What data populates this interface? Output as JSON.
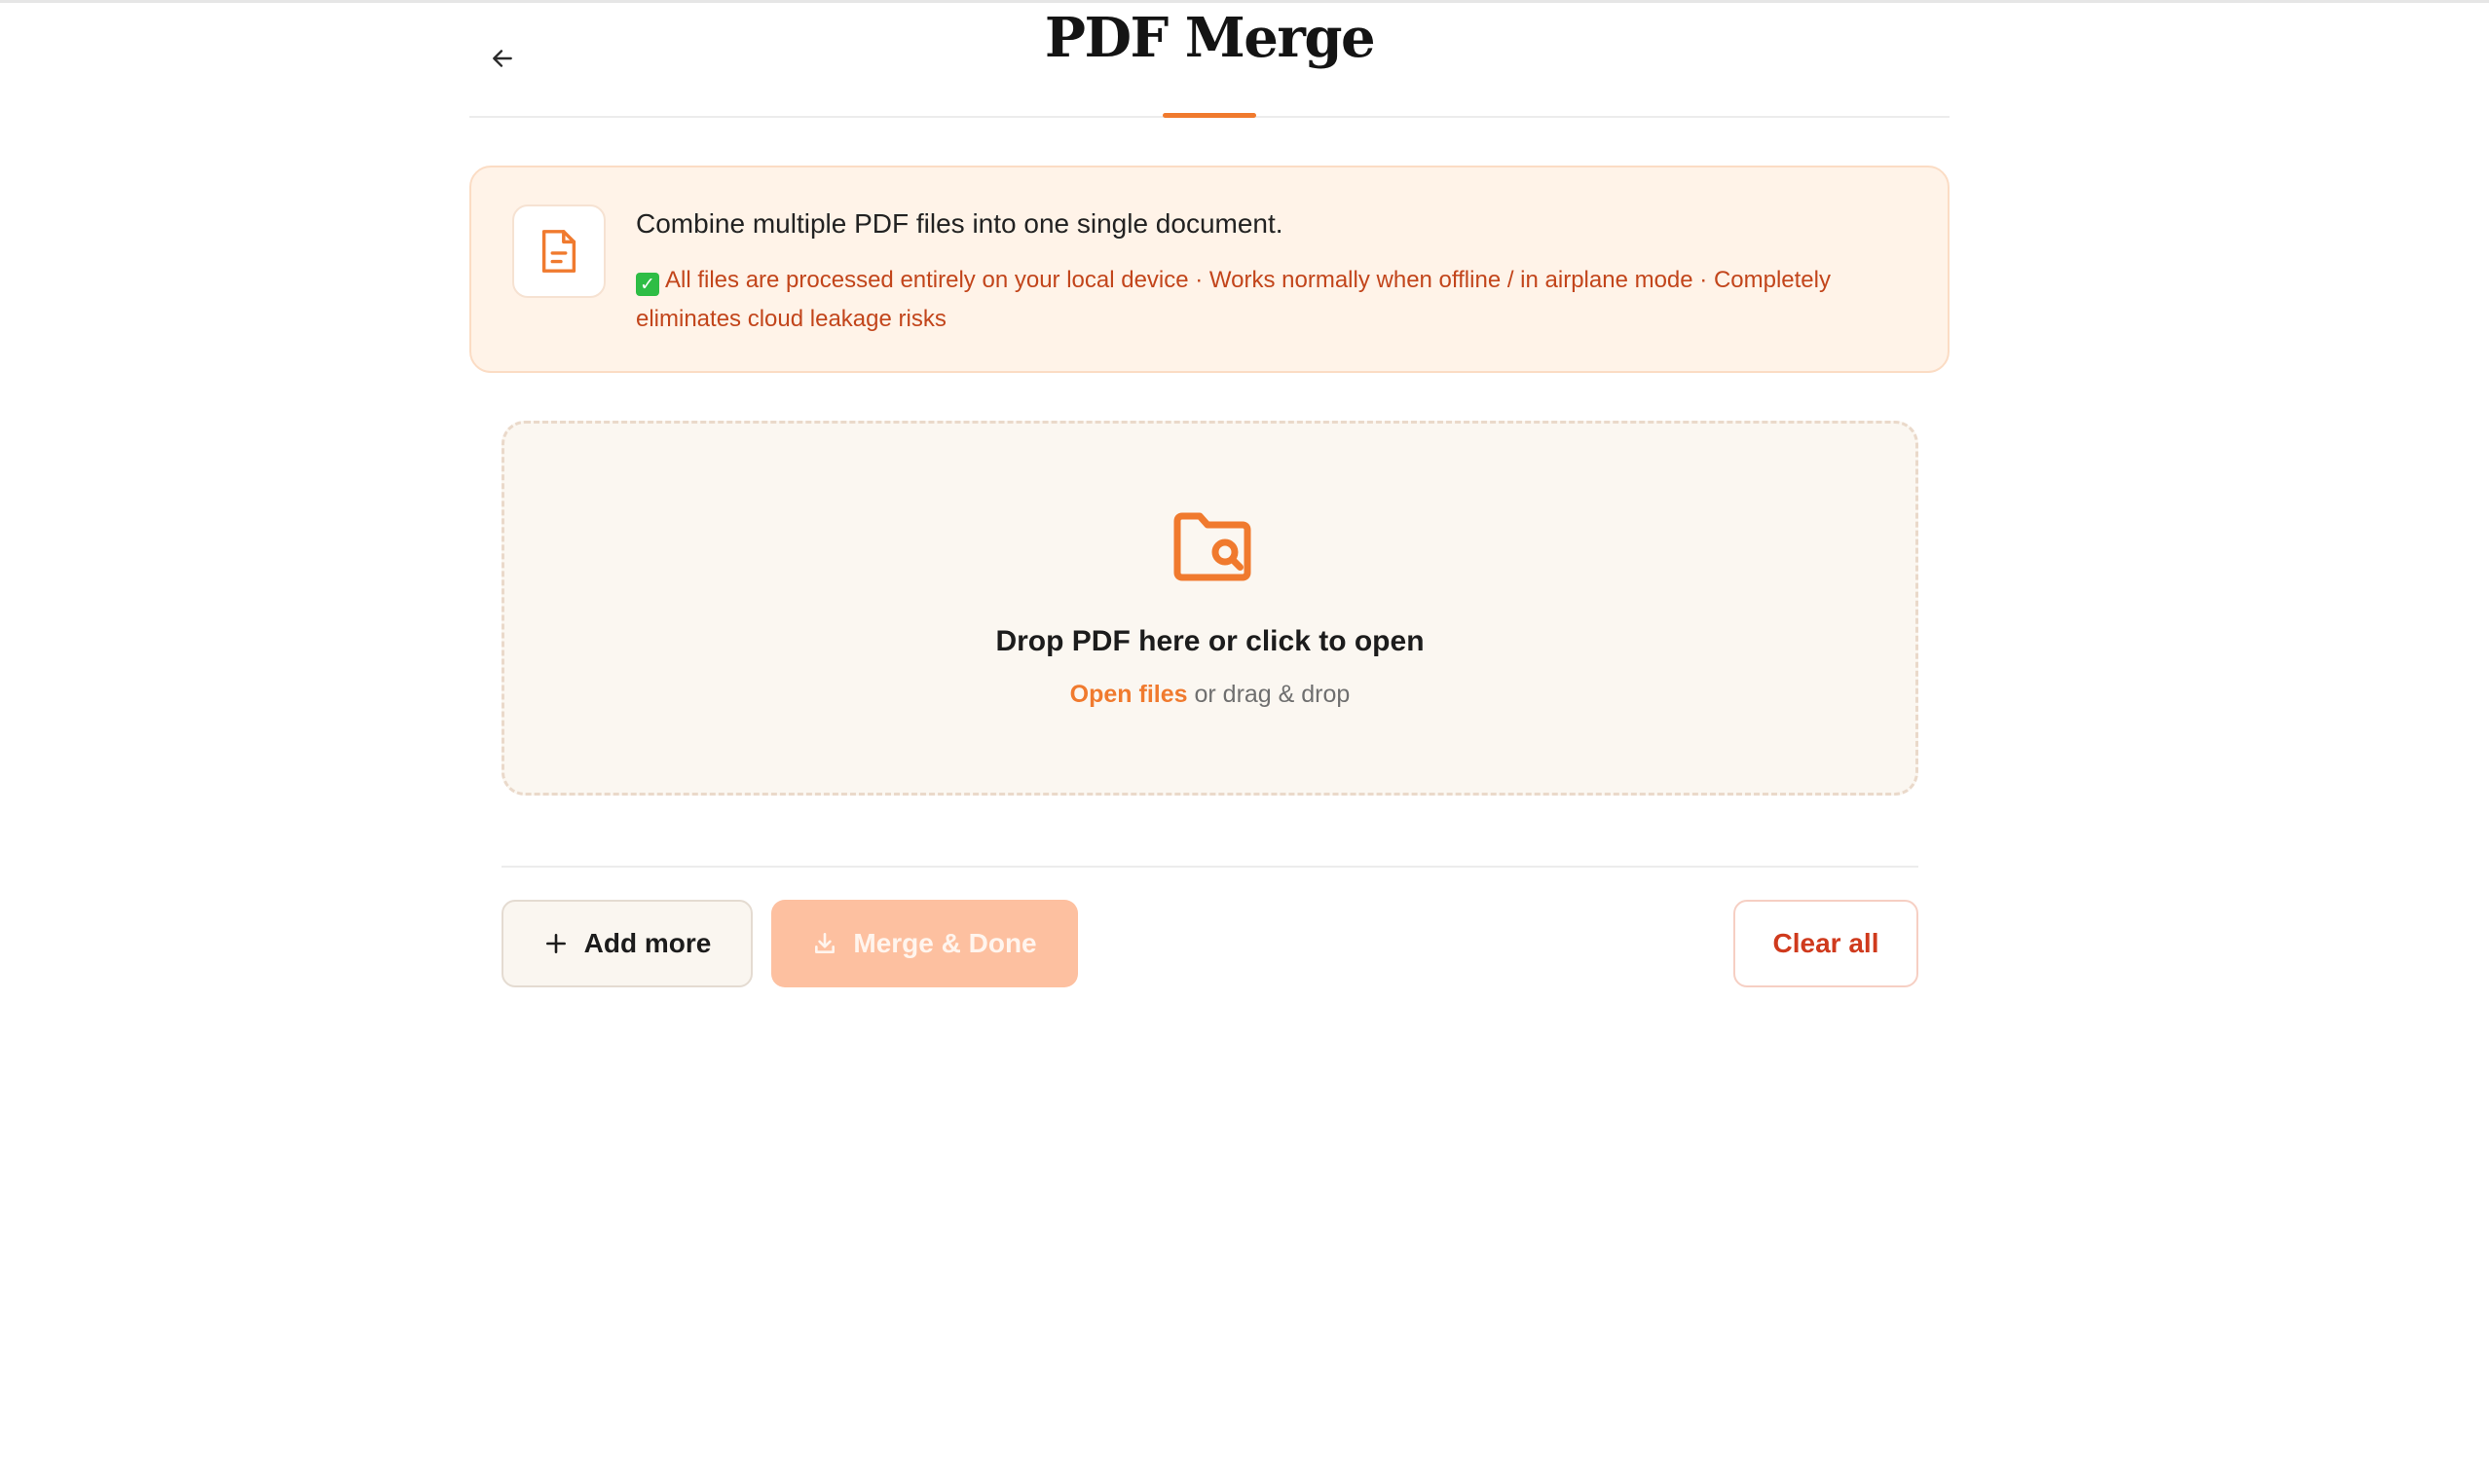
{
  "header": {
    "title": "PDF Merge",
    "back_icon": "arrow-left-icon"
  },
  "banner": {
    "icon": "document-icon",
    "title": "Combine multiple PDF files into one single document.",
    "note_check_icon": "check-box-icon",
    "note": "All files are processed entirely on your local device · Works normally when offline / in airplane mode · Completely eliminates cloud leakage risks"
  },
  "dropzone": {
    "icon": "folder-search-icon",
    "title": "Drop PDF here or click to open",
    "link_label": "Open files",
    "sub_label": " or drag & drop"
  },
  "actions": {
    "add_label": "Add more",
    "add_icon": "plus-icon",
    "merge_label": "Merge & Done",
    "merge_icon": "download-icon",
    "clear_label": "Clear all"
  },
  "colors": {
    "accent": "#f07a2e",
    "banner_bg": "#fff3e8",
    "warning_text": "#c2451b",
    "danger": "#cf3a1d",
    "merge_disabled": "#fdc0a0"
  }
}
